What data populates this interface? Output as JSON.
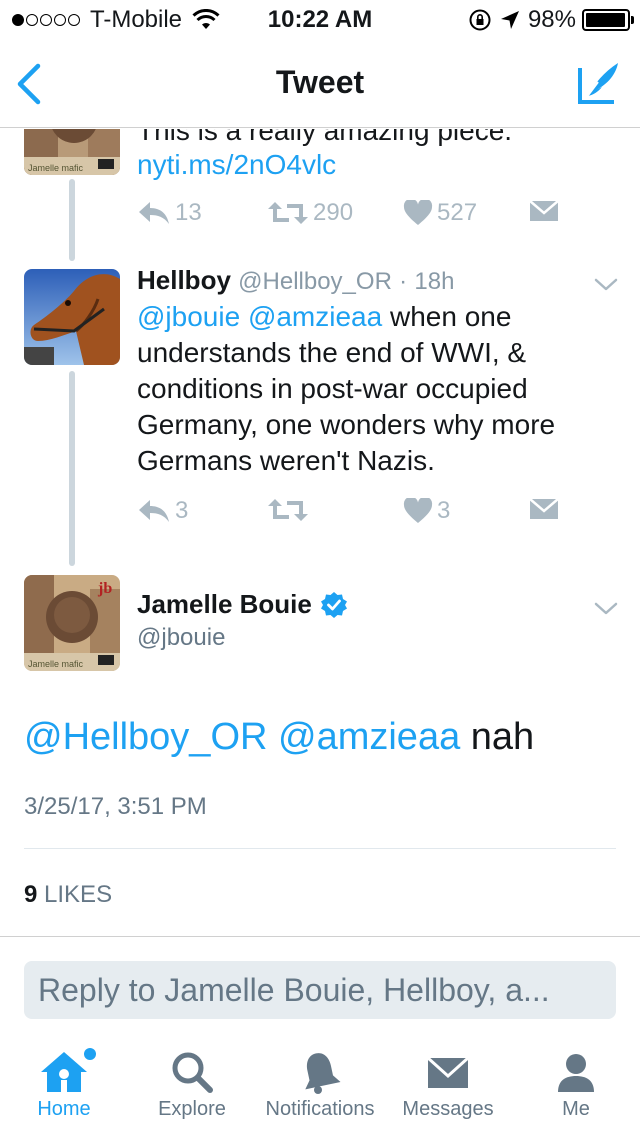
{
  "status_bar": {
    "carrier": "T-Mobile",
    "time": "10:22 AM",
    "battery": "98%",
    "battery_level": 0.98,
    "signal_bars_filled": 1,
    "signal_bars_total": 5
  },
  "nav": {
    "title": "Tweet",
    "back_icon": "chevron-left-icon",
    "compose_icon": "compose-quill-icon",
    "accent_color": "#1da1f2"
  },
  "tweets": [
    {
      "text_partial": "This is a really amazing piece.",
      "link": "nyti.ms/2nO4vlc",
      "avatar_caption": "Jamelle mafic",
      "actions": {
        "reply_count": "13",
        "retweet_count": "290",
        "like_count": "527"
      }
    },
    {
      "name": "Hellboy",
      "handle": "@Hellboy_OR",
      "separator": "·",
      "time": "18h",
      "mention_1": "@jbouie",
      "mention_2": "@amzieaa",
      "text_line_1_rest": " when one",
      "text_line_2": "understands the end of WWI, &",
      "text_line_3": "conditions in post-war occupied",
      "text_line_4": "Germany, one wonders why more",
      "text_line_5": "Germans weren't Nazis.",
      "actions": {
        "reply_count": "3",
        "like_count": "3"
      }
    }
  ],
  "main_tweet": {
    "name": "Jamelle Bouie",
    "handle": "@jbouie",
    "avatar_caption": "Jamelle mafic",
    "avatar_badge": "jb",
    "mention_1": "@Hellboy_OR",
    "mention_2": "@amzieaa",
    "text_rest": " nah",
    "timestamp": "3/25/17, 3:51 PM",
    "likes_count": "9",
    "likes_label": "LIKES"
  },
  "reply": {
    "placeholder": "Reply to Jamelle Bouie, Hellboy, a..."
  },
  "tab_bar": {
    "tabs": [
      {
        "label": "Home",
        "icon": "home-icon",
        "active": true
      },
      {
        "label": "Explore",
        "icon": "search-icon",
        "active": false
      },
      {
        "label": "Notifications",
        "icon": "bell-icon",
        "active": false
      },
      {
        "label": "Messages",
        "icon": "envelope-icon",
        "active": false
      },
      {
        "label": "Me",
        "icon": "person-icon",
        "active": false
      }
    ]
  },
  "colors": {
    "link": "#1da1f2",
    "muted": "#657786",
    "action_gray": "#aab8c2",
    "thread_line": "#ccd6dd"
  }
}
